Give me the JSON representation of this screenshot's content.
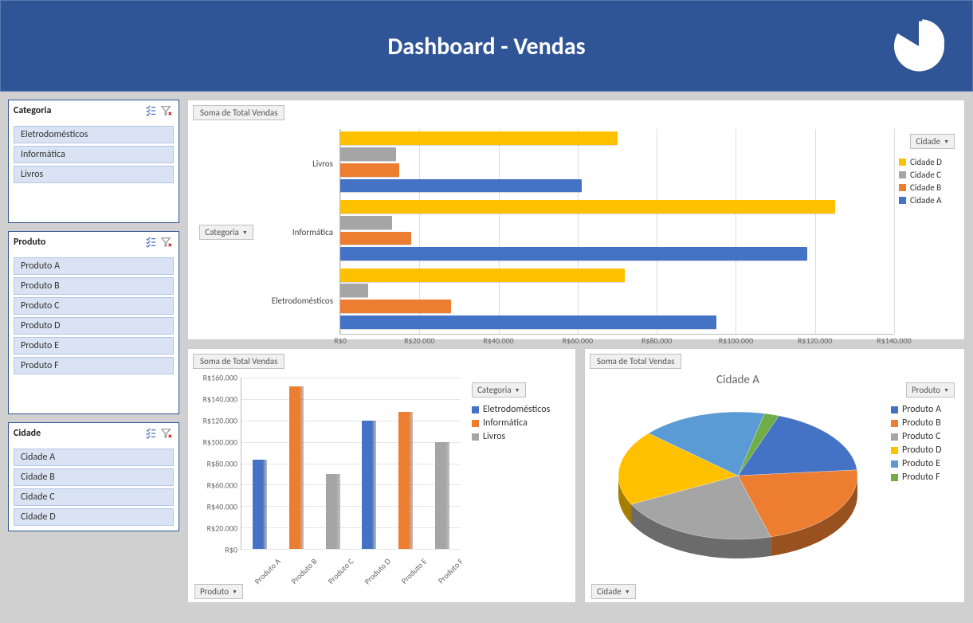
{
  "header": {
    "title": "Dashboard - Vendas"
  },
  "slicers": {
    "categoria": {
      "title": "Categoria",
      "items": [
        "Eletrodomésticos",
        "Informática",
        "Livros"
      ]
    },
    "produto": {
      "title": "Produto",
      "items": [
        "Produto A",
        "Produto B",
        "Produto C",
        "Produto D",
        "Produto E",
        "Produto F"
      ]
    },
    "cidade": {
      "title": "Cidade",
      "items": [
        "Cidade A",
        "Cidade B",
        "Cidade C",
        "Cidade D"
      ]
    }
  },
  "field_buttons": {
    "categoria": "Categoria",
    "produto": "Produto",
    "cidade": "Cidade"
  },
  "panels": {
    "top": {
      "title": "Soma de Total Vendas"
    },
    "bl": {
      "title": "Soma de Total Vendas"
    },
    "br": {
      "title": "Soma de Total Vendas"
    }
  },
  "colors": {
    "blue": "#4472c4",
    "orange": "#ed7d31",
    "gray": "#a5a5a5",
    "yellow": "#ffc000",
    "lblue": "#5b9bd5",
    "green": "#70ad47"
  },
  "chart_data": [
    {
      "id": "top_hbar",
      "type": "bar",
      "orientation": "horizontal",
      "title": "Soma de Total Vendas",
      "xlabel": "",
      "ylabel": "Categoria",
      "x_ticks_labels": [
        "R$0",
        "R$20.000",
        "R$40.000",
        "R$60.000",
        "R$80.000",
        "R$100.000",
        "R$120.000",
        "R$140.000"
      ],
      "x_ticks_values": [
        0,
        20000,
        40000,
        60000,
        80000,
        100000,
        120000,
        140000
      ],
      "xlim": [
        0,
        140000
      ],
      "categories": [
        "Livros",
        "Informática",
        "Eletrodomésticos"
      ],
      "series": [
        {
          "name": "Cidade D",
          "color": "yellow",
          "values": [
            70000,
            125000,
            72000
          ]
        },
        {
          "name": "Cidade C",
          "color": "gray",
          "values": [
            14000,
            13000,
            7000
          ]
        },
        {
          "name": "Cidade B",
          "color": "orange",
          "values": [
            15000,
            18000,
            28000
          ]
        },
        {
          "name": "Cidade A",
          "color": "blue",
          "values": [
            61000,
            118000,
            95000
          ]
        }
      ],
      "legend": [
        "Cidade D",
        "Cidade C",
        "Cidade B",
        "Cidade A"
      ]
    },
    {
      "id": "bl_column",
      "type": "bar",
      "orientation": "vertical",
      "title": "Soma de Total Vendas",
      "xlabel": "Produto",
      "ylabel": "",
      "y_ticks_labels": [
        "R$0",
        "R$20.000",
        "R$40.000",
        "R$60.000",
        "R$80.000",
        "R$100.000",
        "R$120.000",
        "R$140.000",
        "R$160.000"
      ],
      "y_ticks_values": [
        0,
        20000,
        40000,
        60000,
        80000,
        100000,
        120000,
        140000,
        160000
      ],
      "ylim": [
        0,
        160000
      ],
      "categories": [
        "Produto A",
        "Produto B",
        "Produto C",
        "Produto D",
        "Produto E",
        "Produto F"
      ],
      "series_assignment": [
        "Eletrodomésticos",
        "Informática",
        "Livros",
        "Eletrodomésticos",
        "Informática",
        "Livros"
      ],
      "values": [
        83000,
        152000,
        70000,
        120000,
        128000,
        100000
      ],
      "legend": [
        {
          "label": "Eletrodomésticos",
          "color": "blue"
        },
        {
          "label": "Informática",
          "color": "orange"
        },
        {
          "label": "Livros",
          "color": "gray"
        }
      ]
    },
    {
      "id": "br_pie",
      "type": "pie",
      "title": "Cidade A",
      "values": [
        {
          "label": "Produto A",
          "value": 18,
          "color": "blue"
        },
        {
          "label": "Produto B",
          "value": 22,
          "color": "orange"
        },
        {
          "label": "Produto C",
          "value": 22,
          "color": "gray"
        },
        {
          "label": "Produto D",
          "value": 19,
          "color": "yellow"
        },
        {
          "label": "Produto E",
          "value": 17,
          "color": "lblue"
        },
        {
          "label": "Produto F",
          "value": 2,
          "color": "green"
        }
      ]
    }
  ]
}
